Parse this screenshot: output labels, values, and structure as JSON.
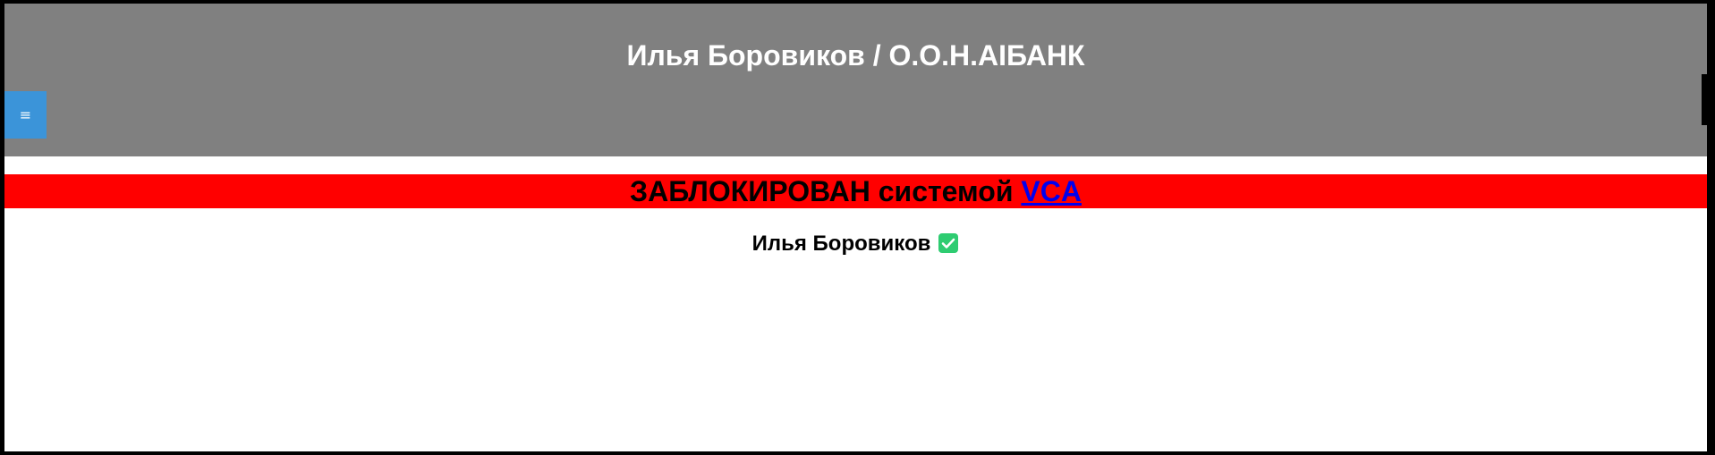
{
  "header": {
    "title": "Илья Боровиков / О.О.Н.AIБАНК",
    "menu_label": "≡"
  },
  "banner": {
    "text": "ЗАБЛОКИРОВАН системой ",
    "link_text": "VCA"
  },
  "user": {
    "name": "Илья Боровиков",
    "verified_icon": "checkbox-checked-icon"
  },
  "colors": {
    "header_bg": "#808080",
    "menu_button_bg": "#3b94d9",
    "banner_bg": "#ff0000",
    "link": "#0000ee",
    "verified": "#2ecc71"
  }
}
